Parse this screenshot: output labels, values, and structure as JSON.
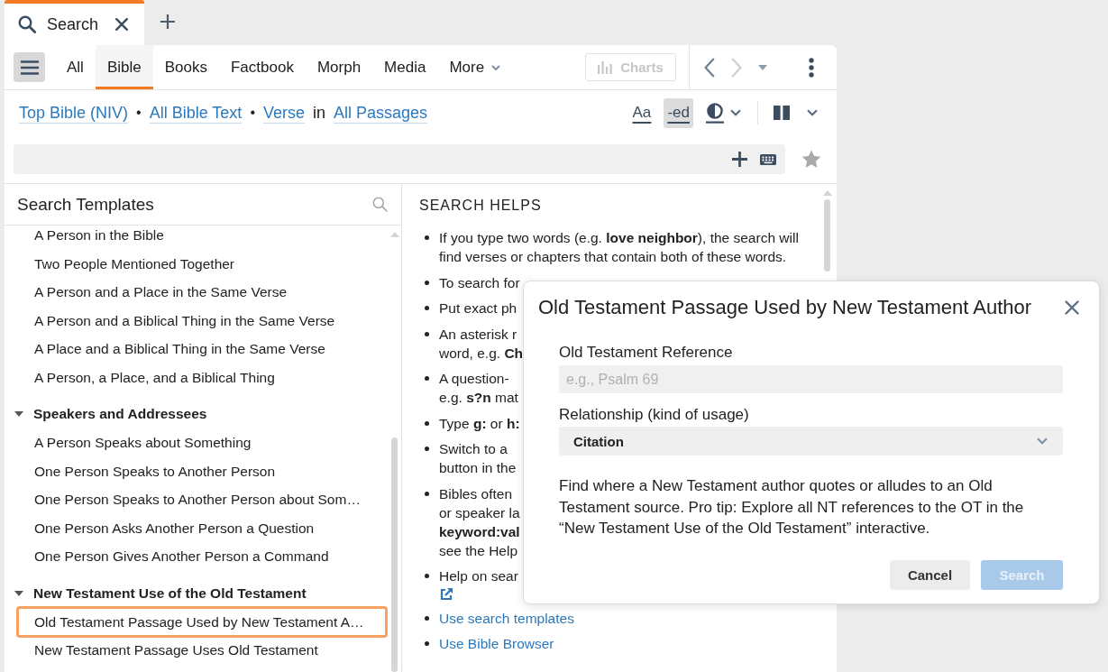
{
  "tabs": [
    {
      "label": "Search",
      "selected": true
    }
  ],
  "toolbar": {
    "tabs": [
      {
        "label": "All",
        "selected": false,
        "kind": "tab"
      },
      {
        "label": "Bible",
        "selected": true,
        "kind": "tab"
      },
      {
        "label": "Books",
        "selected": false,
        "kind": "tab"
      },
      {
        "label": "Factbook",
        "selected": false,
        "kind": "tab"
      },
      {
        "label": "Morph",
        "selected": false,
        "kind": "tab"
      },
      {
        "label": "Media",
        "selected": false,
        "kind": "tab"
      },
      {
        "label": "More",
        "selected": false,
        "kind": "menu"
      }
    ],
    "charts_button": {
      "label": "Charts",
      "disabled": true
    },
    "nav": [
      {
        "kind": "back",
        "disabled": false
      },
      {
        "kind": "forward",
        "disabled": true
      },
      {
        "kind": "history",
        "disabled": false
      }
    ]
  },
  "scope_bar": {
    "parts": [
      {
        "kind": "link",
        "text": "Top Bible (NIV)"
      },
      {
        "kind": "separator",
        "text": "•"
      },
      {
        "kind": "link",
        "text": "All Bible Text"
      },
      {
        "kind": "separator",
        "text": "•"
      },
      {
        "kind": "link",
        "text": "Verse"
      },
      {
        "kind": "text",
        "text": "in"
      },
      {
        "kind": "link",
        "text": "All Passages"
      }
    ],
    "view_toggles": [
      {
        "label": "Aa",
        "selected": false
      },
      {
        "label": "-ed",
        "selected": true
      }
    ]
  },
  "templates_panel": {
    "title": "Search Templates",
    "sections": [
      {
        "items": [
          {
            "label": "A Person in the Bible",
            "selected": false
          },
          {
            "label": "Two People Mentioned Together",
            "selected": false
          },
          {
            "label": "A Person and a Place in the Same Verse",
            "selected": false
          },
          {
            "label": "A Person and a Biblical Thing in the Same Verse",
            "selected": false
          },
          {
            "label": "A Place and a Biblical Thing in the Same Verse",
            "selected": false
          },
          {
            "label": "A Person, a Place, and a Biblical Thing",
            "selected": false
          }
        ]
      },
      {
        "title": "Speakers and Addressees",
        "expanded": true,
        "items": [
          {
            "label": "A Person Speaks about Something",
            "selected": false
          },
          {
            "label": "One Person Speaks to Another Person",
            "selected": false
          },
          {
            "label": "One Person Speaks to Another Person about Som…",
            "selected": false
          },
          {
            "label": "One Person Asks Another Person a Question",
            "selected": false
          },
          {
            "label": "One Person Gives Another Person a Command",
            "selected": false
          }
        ]
      },
      {
        "title": "New Testament Use of the Old Testament",
        "expanded": true,
        "items": [
          {
            "label": "Old Testament Passage Used by New Testament A…",
            "selected": true
          },
          {
            "label": "New Testament Passage Uses Old Testament",
            "selected": false
          }
        ]
      }
    ]
  },
  "help_panel": {
    "title": "SEARCH HELPS",
    "bullets": [
      {
        "kind": "text",
        "lines": [
          "If you type two words (e.g. **love neighbor**), the search will",
          "find verses or chapters that contain both of these words."
        ]
      },
      {
        "kind": "text",
        "lines": [
          "To search for"
        ]
      },
      {
        "kind": "text",
        "lines": [
          "Put exact ph"
        ]
      },
      {
        "kind": "text",
        "lines": [
          "An asterisk r",
          "word, e.g. **Ch**"
        ]
      },
      {
        "kind": "text",
        "lines": [
          "A question-",
          "e.g. **s?n** mat"
        ]
      },
      {
        "kind": "text",
        "lines": [
          "Type **g:** or **h:**"
        ]
      },
      {
        "kind": "text",
        "lines": [
          "Switch to a",
          "button in the"
        ]
      },
      {
        "kind": "text",
        "lines": [
          "Bibles often",
          "or speaker la",
          "**keyword:val**",
          "see the Help"
        ]
      },
      {
        "kind": "text",
        "lines": [
          "Help on sear"
        ],
        "external_link": true
      },
      {
        "kind": "link",
        "lines": [
          "Use search templates"
        ]
      },
      {
        "kind": "link",
        "lines": [
          "Use Bible Browser"
        ]
      }
    ]
  },
  "dialog": {
    "title": "Old Testament Passage Used by New Testament Author",
    "fields": [
      {
        "kind": "input",
        "label": "Old Testament Reference",
        "placeholder": "e.g., Psalm 69"
      },
      {
        "kind": "select",
        "label": "Relationship (kind of usage)",
        "value": "Citation"
      }
    ],
    "description": "Find where a New Testament author quotes or alludes to an Old Testament source. Pro tip: Explore all NT references to the OT in the “New Testament Use of the Old Testament” interactive.",
    "buttons": [
      {
        "kind": "cancel",
        "label": "Cancel",
        "disabled": false
      },
      {
        "kind": "submit",
        "label": "Search",
        "disabled": true
      }
    ]
  }
}
